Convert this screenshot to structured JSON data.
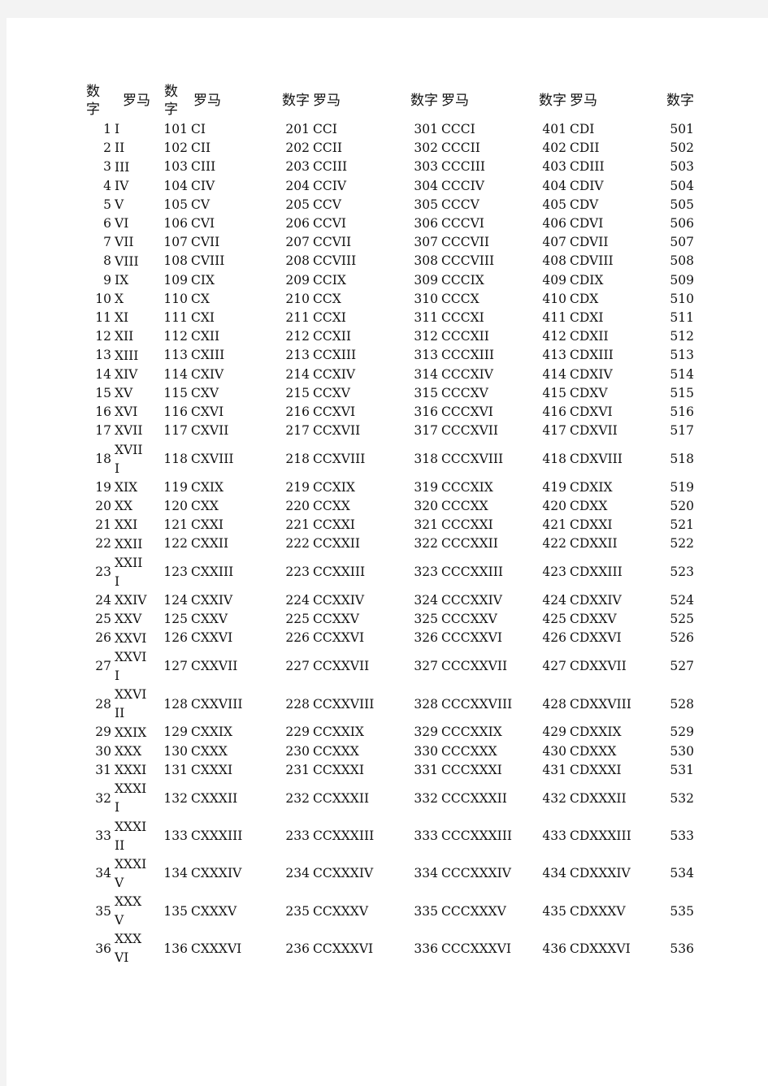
{
  "headers": {
    "number": "数字",
    "roman": "罗马"
  },
  "rows": [
    {
      "n1": "1",
      "r1": "I",
      "n2": "101",
      "r2": "CI",
      "n3": "201",
      "r3": "CCI",
      "n4": "301",
      "r4": "CCCI",
      "n5": "401",
      "r5": "CDI",
      "n6": "501"
    },
    {
      "n1": "2",
      "r1": "II",
      "n2": "102",
      "r2": "CII",
      "n3": "202",
      "r3": "CCII",
      "n4": "302",
      "r4": "CCCII",
      "n5": "402",
      "r5": "CDII",
      "n6": "502"
    },
    {
      "n1": "3",
      "r1": "III",
      "n2": "103",
      "r2": "CIII",
      "n3": "203",
      "r3": "CCIII",
      "n4": "303",
      "r4": "CCCIII",
      "n5": "403",
      "r5": "CDIII",
      "n6": "503"
    },
    {
      "n1": "4",
      "r1": "IV",
      "n2": "104",
      "r2": "CIV",
      "n3": "204",
      "r3": "CCIV",
      "n4": "304",
      "r4": "CCCIV",
      "n5": "404",
      "r5": "CDIV",
      "n6": "504"
    },
    {
      "n1": "5",
      "r1": "V",
      "n2": "105",
      "r2": "CV",
      "n3": "205",
      "r3": "CCV",
      "n4": "305",
      "r4": "CCCV",
      "n5": "405",
      "r5": "CDV",
      "n6": "505"
    },
    {
      "n1": "6",
      "r1": "VI",
      "n2": "106",
      "r2": "CVI",
      "n3": "206",
      "r3": "CCVI",
      "n4": "306",
      "r4": "CCCVI",
      "n5": "406",
      "r5": "CDVI",
      "n6": "506"
    },
    {
      "n1": "7",
      "r1": "VII",
      "n2": "107",
      "r2": "CVII",
      "n3": "207",
      "r3": "CCVII",
      "n4": "307",
      "r4": "CCCVII",
      "n5": "407",
      "r5": "CDVII",
      "n6": "507"
    },
    {
      "n1": "8",
      "r1": "VIII",
      "n2": "108",
      "r2": "CVIII",
      "n3": "208",
      "r3": "CCVIII",
      "n4": "308",
      "r4": "CCCVIII",
      "n5": "408",
      "r5": "CDVIII",
      "n6": "508"
    },
    {
      "n1": "9",
      "r1": "IX",
      "n2": "109",
      "r2": "CIX",
      "n3": "209",
      "r3": "CCIX",
      "n4": "309",
      "r4": "CCCIX",
      "n5": "409",
      "r5": "CDIX",
      "n6": "509"
    },
    {
      "n1": "10",
      "r1": "X",
      "n2": "110",
      "r2": "CX",
      "n3": "210",
      "r3": "CCX",
      "n4": "310",
      "r4": "CCCX",
      "n5": "410",
      "r5": "CDX",
      "n6": "510"
    },
    {
      "n1": "11",
      "r1": "XI",
      "n2": "111",
      "r2": "CXI",
      "n3": "211",
      "r3": "CCXI",
      "n4": "311",
      "r4": "CCCXI",
      "n5": "411",
      "r5": "CDXI",
      "n6": "511"
    },
    {
      "n1": "12",
      "r1": "XII",
      "n2": "112",
      "r2": "CXII",
      "n3": "212",
      "r3": "CCXII",
      "n4": "312",
      "r4": "CCCXII",
      "n5": "412",
      "r5": "CDXII",
      "n6": "512"
    },
    {
      "n1": "13",
      "r1": "XIII",
      "n2": "113",
      "r2": "CXIII",
      "n3": "213",
      "r3": "CCXIII",
      "n4": "313",
      "r4": "CCCXIII",
      "n5": "413",
      "r5": "CDXIII",
      "n6": "513"
    },
    {
      "n1": "14",
      "r1": "XIV",
      "n2": "114",
      "r2": "CXIV",
      "n3": "214",
      "r3": "CCXIV",
      "n4": "314",
      "r4": "CCCXIV",
      "n5": "414",
      "r5": "CDXIV",
      "n6": "514"
    },
    {
      "n1": "15",
      "r1": "XV",
      "n2": "115",
      "r2": "CXV",
      "n3": "215",
      "r3": "CCXV",
      "n4": "315",
      "r4": "CCCXV",
      "n5": "415",
      "r5": "CDXV",
      "n6": "515"
    },
    {
      "n1": "16",
      "r1": "XVI",
      "n2": "116",
      "r2": "CXVI",
      "n3": "216",
      "r3": "CCXVI",
      "n4": "316",
      "r4": "CCCXVI",
      "n5": "416",
      "r5": "CDXVI",
      "n6": "516"
    },
    {
      "n1": "17",
      "r1": "XVII",
      "n2": "117",
      "r2": "CXVII",
      "n3": "217",
      "r3": "CCXVII",
      "n4": "317",
      "r4": "CCCXVII",
      "n5": "417",
      "r5": "CDXVII",
      "n6": "517"
    },
    {
      "n1": "18",
      "r1": "XVIII",
      "n2": "118",
      "r2": "CXVIII",
      "n3": "218",
      "r3": "CCXVIII",
      "n4": "318",
      "r4": "CCCXVIII",
      "n5": "418",
      "r5": "CDXVIII",
      "n6": "518",
      "wrap": true
    },
    {
      "n1": "19",
      "r1": "XIX",
      "n2": "119",
      "r2": "CXIX",
      "n3": "219",
      "r3": "CCXIX",
      "n4": "319",
      "r4": "CCCXIX",
      "n5": "419",
      "r5": "CDXIX",
      "n6": "519"
    },
    {
      "n1": "20",
      "r1": "XX",
      "n2": "120",
      "r2": "CXX",
      "n3": "220",
      "r3": "CCXX",
      "n4": "320",
      "r4": "CCCXX",
      "n5": "420",
      "r5": "CDXX",
      "n6": "520"
    },
    {
      "n1": "21",
      "r1": "XXI",
      "n2": "121",
      "r2": "CXXI",
      "n3": "221",
      "r3": "CCXXI",
      "n4": "321",
      "r4": "CCCXXI",
      "n5": "421",
      "r5": "CDXXI",
      "n6": "521"
    },
    {
      "n1": "22",
      "r1": "XXII",
      "n2": "122",
      "r2": "CXXII",
      "n3": "222",
      "r3": "CCXXII",
      "n4": "322",
      "r4": "CCCXXII",
      "n5": "422",
      "r5": "CDXXII",
      "n6": "522"
    },
    {
      "n1": "23",
      "r1": "XXIII",
      "n2": "123",
      "r2": "CXXIII",
      "n3": "223",
      "r3": "CCXXIII",
      "n4": "323",
      "r4": "CCCXXIII",
      "n5": "423",
      "r5": "CDXXIII",
      "n6": "523",
      "wrap": true
    },
    {
      "n1": "24",
      "r1": "XXIV",
      "n2": "124",
      "r2": "CXXIV",
      "n3": "224",
      "r3": "CCXXIV",
      "n4": "324",
      "r4": "CCCXXIV",
      "n5": "424",
      "r5": "CDXXIV",
      "n6": "524"
    },
    {
      "n1": "25",
      "r1": "XXV",
      "n2": "125",
      "r2": "CXXV",
      "n3": "225",
      "r3": "CCXXV",
      "n4": "325",
      "r4": "CCCXXV",
      "n5": "425",
      "r5": "CDXXV",
      "n6": "525"
    },
    {
      "n1": "26",
      "r1": "XXVI",
      "n2": "126",
      "r2": "CXXVI",
      "n3": "226",
      "r3": "CCXXVI",
      "n4": "326",
      "r4": "CCCXXVI",
      "n5": "426",
      "r5": "CDXXVI",
      "n6": "526"
    },
    {
      "n1": "27",
      "r1": "XXVII",
      "n2": "127",
      "r2": "CXXVII",
      "n3": "227",
      "r3": "CCXXVII",
      "n4": "327",
      "r4": "CCCXXVII",
      "n5": "427",
      "r5": "CDXXVII",
      "n6": "527",
      "wrap": true
    },
    {
      "n1": "28",
      "r1": "XXVIII",
      "n2": "128",
      "r2": "CXXVIII",
      "n3": "228",
      "r3": "CCXXVIII",
      "n4": "328",
      "r4": "CCCXXVIII",
      "n5": "428",
      "r5": "CDXXVIII",
      "n6": "528",
      "wrap": true
    },
    {
      "n1": "29",
      "r1": "XXIX",
      "n2": "129",
      "r2": "CXXIX",
      "n3": "229",
      "r3": "CCXXIX",
      "n4": "329",
      "r4": "CCCXXIX",
      "n5": "429",
      "r5": "CDXXIX",
      "n6": "529"
    },
    {
      "n1": "30",
      "r1": "XXX",
      "n2": "130",
      "r2": "CXXX",
      "n3": "230",
      "r3": "CCXXX",
      "n4": "330",
      "r4": "CCCXXX",
      "n5": "430",
      "r5": "CDXXX",
      "n6": "530"
    },
    {
      "n1": "31",
      "r1": "XXXI",
      "n2": "131",
      "r2": "CXXXI",
      "n3": "231",
      "r3": "CCXXXI",
      "n4": "331",
      "r4": "CCCXXXI",
      "n5": "431",
      "r5": "CDXXXI",
      "n6": "531"
    },
    {
      "n1": "32",
      "r1": "XXXII",
      "n2": "132",
      "r2": "CXXXII",
      "n3": "232",
      "r3": "CCXXXII",
      "n4": "332",
      "r4": "CCCXXXII",
      "n5": "432",
      "r5": "CDXXXII",
      "n6": "532",
      "wrap": true
    },
    {
      "n1": "33",
      "r1": "XXXIII",
      "n2": "133",
      "r2": "CXXXIII",
      "n3": "233",
      "r3": "CCXXXIII",
      "n4": "333",
      "r4": "CCCXXXIII",
      "n5": "433",
      "r5": "CDXXXIII",
      "n6": "533",
      "wrap": true
    },
    {
      "n1": "34",
      "r1": "XXXIV",
      "n2": "134",
      "r2": "CXXXIV",
      "n3": "234",
      "r3": "CCXXXIV",
      "n4": "334",
      "r4": "CCCXXXIV",
      "n5": "434",
      "r5": "CDXXXIV",
      "n6": "534",
      "wrap": true
    },
    {
      "n1": "35",
      "r1": "XXXV",
      "n2": "135",
      "r2": "CXXXV",
      "n3": "235",
      "r3": "CCXXXV",
      "n4": "335",
      "r4": "CCCXXXV",
      "n5": "435",
      "r5": "CDXXXV",
      "n6": "535"
    },
    {
      "n1": "36",
      "r1": "XXXVI",
      "n2": "136",
      "r2": "CXXXVI",
      "n3": "236",
      "r3": "CCXXXVI",
      "n4": "336",
      "r4": "CCCXXXVI",
      "n5": "436",
      "r5": "CDXXXVI",
      "n6": "536",
      "wrap": true
    }
  ]
}
